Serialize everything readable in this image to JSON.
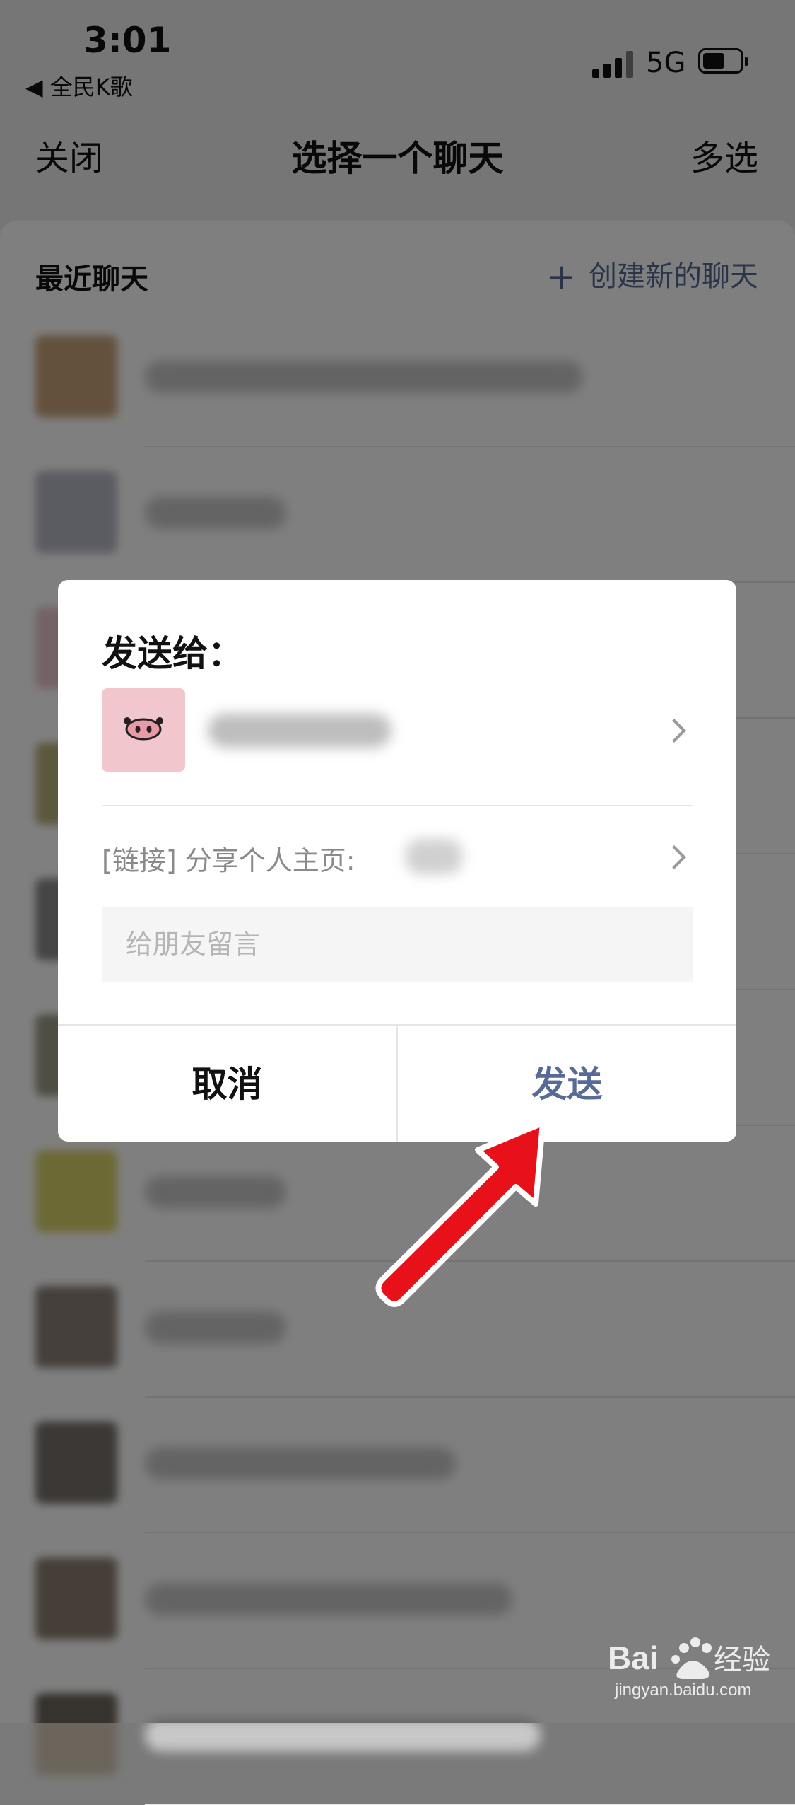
{
  "status_bar": {
    "time": "3:01",
    "back_app": "◀ 全民K歌",
    "network": "5G"
  },
  "nav": {
    "close": "关闭",
    "title": "选择一个聊天",
    "multi_select": "多选"
  },
  "list": {
    "recent_title": "最近聊天",
    "create_new": "创建新的聊天",
    "avatar_colors": [
      "#c9a27a",
      "#b7b7c4",
      "#e9c6cc",
      "#b8b07a",
      "#8a8a8a",
      "#9c9c8a",
      "#d9d36b",
      "#8a8077",
      "#77716a",
      "#8a7f6e",
      "#6c655c"
    ]
  },
  "dialog": {
    "title": "发送给：",
    "share_label": "[链接] 分享个人主页:",
    "message_placeholder": "给朋友留言",
    "cancel": "取消",
    "send": "发送"
  },
  "colors": {
    "accent": "#576b95",
    "arrow": "#e8111a",
    "pig": "#f2c6cd"
  },
  "watermark": {
    "text": "jingyan.baidu.com"
  }
}
